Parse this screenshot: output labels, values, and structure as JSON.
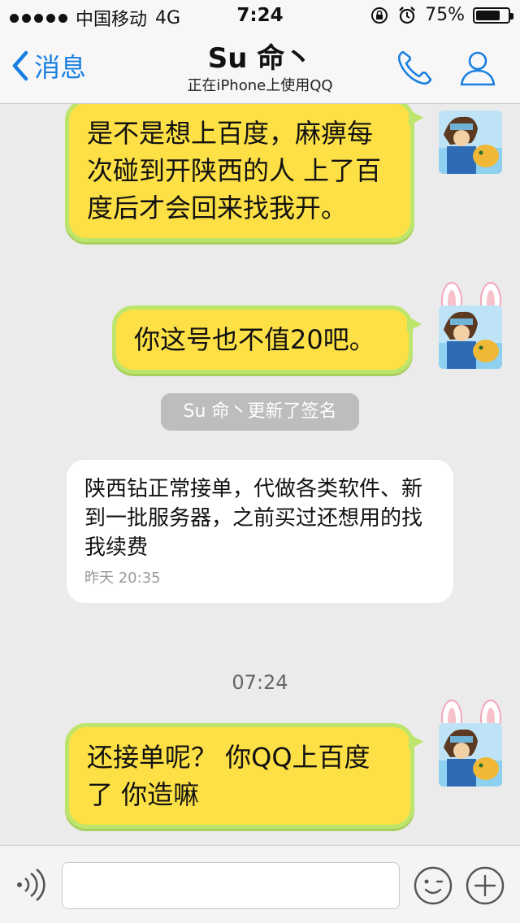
{
  "status_bar": {
    "carrier": "中国移动",
    "network": "4G",
    "time": "7:24",
    "battery_text": "75%",
    "battery_level": 0.75
  },
  "nav": {
    "back_label": "消息",
    "title": "Su 命丶",
    "subtitle": "正在iPhone上使用QQ"
  },
  "messages": [
    {
      "direction": "out",
      "text": "是不是想上百度，麻痹每次碰到开陕西的人 上了百度后才会回来找我开。"
    },
    {
      "direction": "out",
      "text": "你这号也不值20吧。"
    },
    {
      "direction": "in",
      "text": "陕西钻正常接单，代做各类软件、新到一批服务器，之前买过还想用的找我续费",
      "time": "昨天 20:35"
    },
    {
      "direction": "out",
      "text": "还接单呢？ 你QQ上百度了 你造嘛"
    }
  ],
  "system_notice": "Su 命丶更新了签名",
  "timestamp": "07:24",
  "input": {
    "placeholder": ""
  },
  "colors": {
    "accent": "#1a7fe0",
    "bubble_out_fill": "#fde045",
    "bubble_out_border": "#bee56b"
  }
}
